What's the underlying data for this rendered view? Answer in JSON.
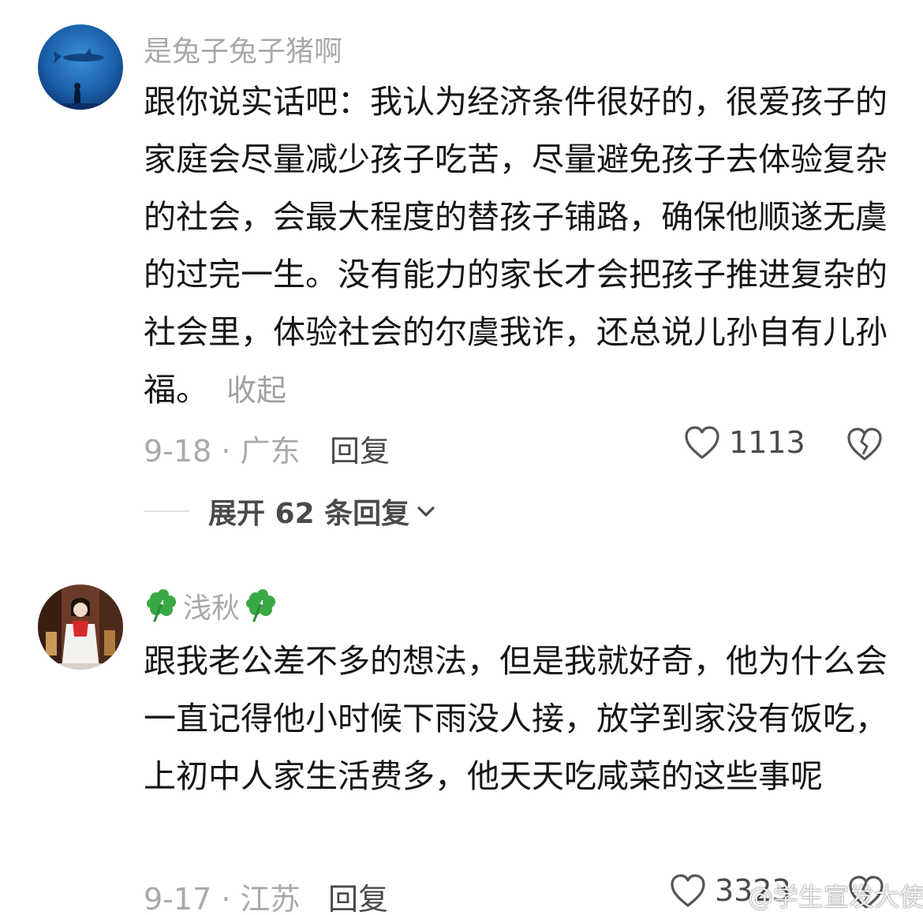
{
  "comments": [
    {
      "username": "是兔子兔子猪啊",
      "body": "跟你说实话吧：我认为经济条件很好的，很爱孩子的家庭会尽量减少孩子吃苦，尽量避免孩子去体验复杂的社会，会最大程度的替孩子铺路，确保他顺遂无虞的过完一生。没有能力的家长才会把孩子推进复杂的社会里，体验社会的尔虞我诈，还总说儿孙自有儿孙福。",
      "collapse_label": "收起",
      "date": "9-18",
      "location": "广东",
      "reply_label": "回复",
      "like_count": "1113",
      "expand_label": "展开 62 条回复"
    },
    {
      "username": "浅秋",
      "body": "跟我老公差不多的想法，但是我就好奇，他为什么会一直记得他小时候下雨没人接，放学到家没有饭吃，上初中人家生活费多，他天天吃咸菜的这些事呢",
      "date": "9-17",
      "location": "江苏",
      "reply_label": "回复",
      "like_count": "3323"
    }
  ],
  "watermark": "@学生宣发大使",
  "icons": {
    "like": "heart-outline-icon",
    "dislike": "broken-heart-icon",
    "expand": "chevron-down-icon",
    "username_decoration": "four-leaf-clover-icon"
  },
  "colors": {
    "username": "#a9a9a9",
    "body_text": "#161616",
    "meta": "#a9a9a9",
    "action": "#4a4a4a",
    "clover": "#3aa845"
  }
}
